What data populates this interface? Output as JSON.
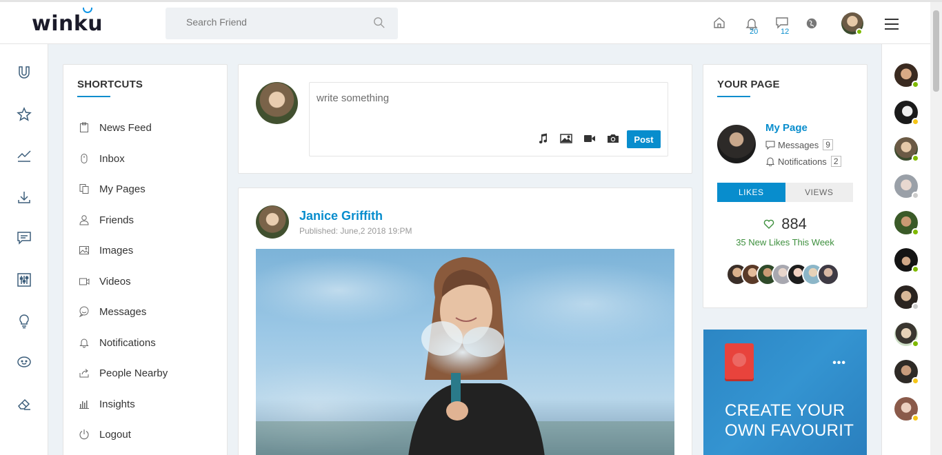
{
  "brand": {
    "logo_text": "winku"
  },
  "search": {
    "placeholder": "Search Friend"
  },
  "top_nav": {
    "notifications_count": "20",
    "messages_count": "12"
  },
  "shortcuts": {
    "title": "SHORTCUTS",
    "items": [
      {
        "label": "News Feed",
        "icon": "clipboard-icon"
      },
      {
        "label": "Inbox",
        "icon": "mouse-icon"
      },
      {
        "label": "My Pages",
        "icon": "files-icon"
      },
      {
        "label": "Friends",
        "icon": "user-icon"
      },
      {
        "label": "Images",
        "icon": "image-icon"
      },
      {
        "label": "Videos",
        "icon": "video-icon"
      },
      {
        "label": "Messages",
        "icon": "chat-smile-icon"
      },
      {
        "label": "Notifications",
        "icon": "bell-icon"
      },
      {
        "label": "People Nearby",
        "icon": "share-icon"
      },
      {
        "label": "Insights",
        "icon": "bar-chart-icon"
      },
      {
        "label": "Logout",
        "icon": "power-icon"
      }
    ]
  },
  "composer": {
    "placeholder": "write something",
    "post_label": "Post"
  },
  "post": {
    "author": "Janice Griffith",
    "published": "Published: June,2 2018 19:PM"
  },
  "your_page": {
    "title": "YOUR PAGE",
    "page_name": "My Page",
    "messages_label": "Messages",
    "messages_count": "9",
    "notifications_label": "Notifications",
    "notifications_count": "2",
    "tab_likes": "LIKES",
    "tab_views": "VIEWS",
    "likes_total": "884",
    "likes_week": "35 New Likes This Week"
  },
  "promo": {
    "text": "CREATE YOUR OWN FAVOURIT",
    "menu": "•••"
  },
  "colors": {
    "accent": "#088dcd",
    "online": "#7fba00",
    "away": "#f5c518",
    "offline": "#cccccc"
  }
}
